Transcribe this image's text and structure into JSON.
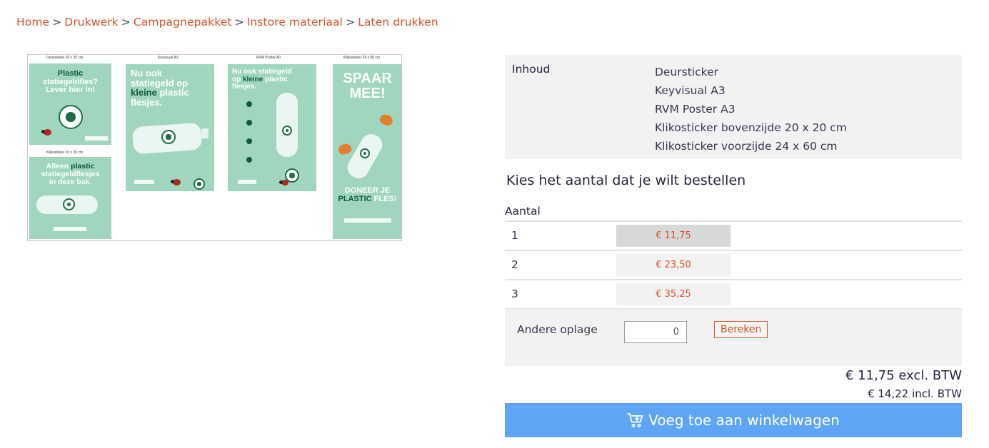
{
  "breadcrumb": {
    "items": [
      "Home",
      "Drukwerk",
      "Campagnepakket",
      "Instore materiaal",
      "Laten drukken"
    ],
    "separator": ">"
  },
  "product_image": {
    "captions": [
      "Deursticker 20 x 20 cm",
      "Keyvisual A3",
      "RVM Poster A3",
      "Klikosticker 24 x 60 cm",
      "Klikosticker 20 x 20 cm"
    ],
    "deursticker_text": [
      "Plastic",
      "statiegeldfles?",
      "Lever hier in!"
    ],
    "keyvisual_text": [
      "Nu ook",
      "statiegeld op",
      "kleine",
      "plastic",
      "flesjes."
    ],
    "rvm_text": [
      "Nu ook statiegeld",
      "op",
      "kleine",
      "plastic",
      "flesjes."
    ],
    "spaar_text": [
      "SPAAR",
      "MEE!"
    ],
    "doneer_text": [
      "DONEER JE",
      "PLASTIC",
      "FLES!"
    ],
    "klikosticker_text": [
      "Alleen",
      "plastic",
      "statiegeldflesjes",
      "in deze bak."
    ]
  },
  "inhoud": {
    "label": "Inhoud",
    "items": [
      "Deursticker",
      "Keyvisual A3",
      "RVM Poster A3",
      "Klikosticker bovenzijde 20 x 20 cm",
      "Klikosticker voorzijde 24 x 60 cm"
    ]
  },
  "order": {
    "heading": "Kies het aantal dat je wilt bestellen",
    "column_header": "Aantal",
    "rows": [
      {
        "quantity": "1",
        "price": "€ 11,75"
      },
      {
        "quantity": "2",
        "price": "€ 23,50"
      },
      {
        "quantity": "3",
        "price": "€ 35,25"
      }
    ],
    "selected_index": 0,
    "other": {
      "label": "Andere oplage",
      "value": "0",
      "button_label": "Bereken"
    }
  },
  "totals": {
    "excl": "€ 11,75 excl. BTW",
    "incl": "€ 14,22 incl. BTW"
  },
  "cart": {
    "button_label": "Voeg toe aan winkelwagen",
    "icon": "cart-plus-icon"
  },
  "colors": {
    "link": "#d4532b",
    "button_bg": "#5ea5f6",
    "panel_bg": "#f2f2f2",
    "poster_green": "#9fd6bd",
    "poster_dark_green": "#0f5a3a"
  }
}
